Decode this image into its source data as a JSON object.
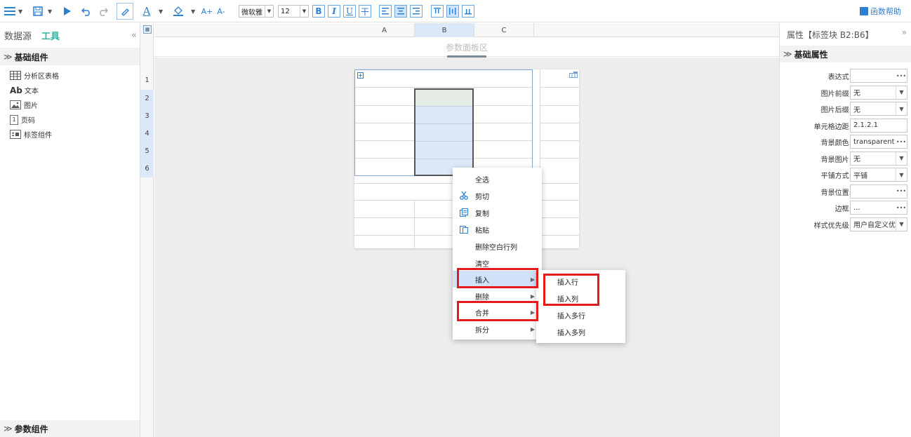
{
  "toolbar": {
    "font_name": "微软雅",
    "font_size": "12",
    "func_help": "函数帮助",
    "bold": "B",
    "italic": "I",
    "underline": "U",
    "strike": "干",
    "font_grow": "A+",
    "font_shrink": "A-",
    "font_color": "A"
  },
  "left_panel": {
    "tabs": [
      {
        "label": "数据源",
        "active": false
      },
      {
        "label": "工具",
        "active": true
      }
    ],
    "collapse_glyph": "«",
    "basic_section": "基础组件",
    "items": [
      {
        "label": "分析区表格",
        "icon": "table-icon"
      },
      {
        "label": "文本",
        "icon": "text-icon",
        "icon_text": "Ab"
      },
      {
        "label": "图片",
        "icon": "image-icon"
      },
      {
        "label": "页码",
        "icon": "page-number-icon"
      },
      {
        "label": "标签组件",
        "icon": "label-icon"
      }
    ],
    "param_section": "参数组件"
  },
  "grid": {
    "columns": [
      "A",
      "B",
      "C"
    ],
    "selected_column": "B",
    "rows": [
      "1",
      "2",
      "3",
      "4",
      "5",
      "6"
    ],
    "selected_rows": [
      "2",
      "3",
      "4",
      "5",
      "6"
    ],
    "param_area_label": "参数面板区"
  },
  "context_menu": {
    "items": [
      {
        "label": "全选",
        "icon": "",
        "submenu": false
      },
      {
        "label": "剪切",
        "icon": "scissors-icon",
        "submenu": false
      },
      {
        "label": "复制",
        "icon": "copy-icon",
        "submenu": false
      },
      {
        "label": "粘贴",
        "icon": "paste-icon",
        "submenu": false
      },
      {
        "label": "删除空白行列",
        "icon": "",
        "submenu": false
      },
      {
        "label": "清空",
        "icon": "",
        "submenu": false
      },
      {
        "label": "插入",
        "icon": "",
        "submenu": true
      },
      {
        "label": "删除",
        "icon": "",
        "submenu": true
      },
      {
        "label": "合并",
        "icon": "",
        "submenu": true
      },
      {
        "label": "拆分",
        "icon": "",
        "submenu": true
      }
    ],
    "active": "插入"
  },
  "submenu": {
    "items": [
      "插入行",
      "插入列",
      "插入多行",
      "插入多列"
    ]
  },
  "right_panel": {
    "title": "属性【标签块 B2:B6】",
    "collapse_glyph": "»",
    "section": "基础属性",
    "properties": [
      {
        "label": "表达式:",
        "value": "",
        "control": "dots"
      },
      {
        "label": "图片前缀:",
        "value": "无",
        "control": "dropdown"
      },
      {
        "label": "图片后缀:",
        "value": "无",
        "control": "dropdown"
      },
      {
        "label": "单元格边距:",
        "value": "2.1.2.1",
        "control": "none"
      },
      {
        "label": "背景颜色:",
        "value": "transparent",
        "control": "dots"
      },
      {
        "label": "背景图片:",
        "value": "无",
        "control": "dropdown"
      },
      {
        "label": "平铺方式:",
        "value": "平铺",
        "control": "dropdown"
      },
      {
        "label": "背景位置:",
        "value": "",
        "control": "dots"
      },
      {
        "label": "边框:",
        "value": "...",
        "control": "dots"
      },
      {
        "label": "样式优先级:",
        "value": "用户自定义优",
        "control": "dropdown"
      }
    ]
  },
  "colors": {
    "accent": "#2c7fd1",
    "tab_active": "#2bb5a3",
    "highlight": "#e31b1b",
    "selection": "#dce9f8"
  }
}
